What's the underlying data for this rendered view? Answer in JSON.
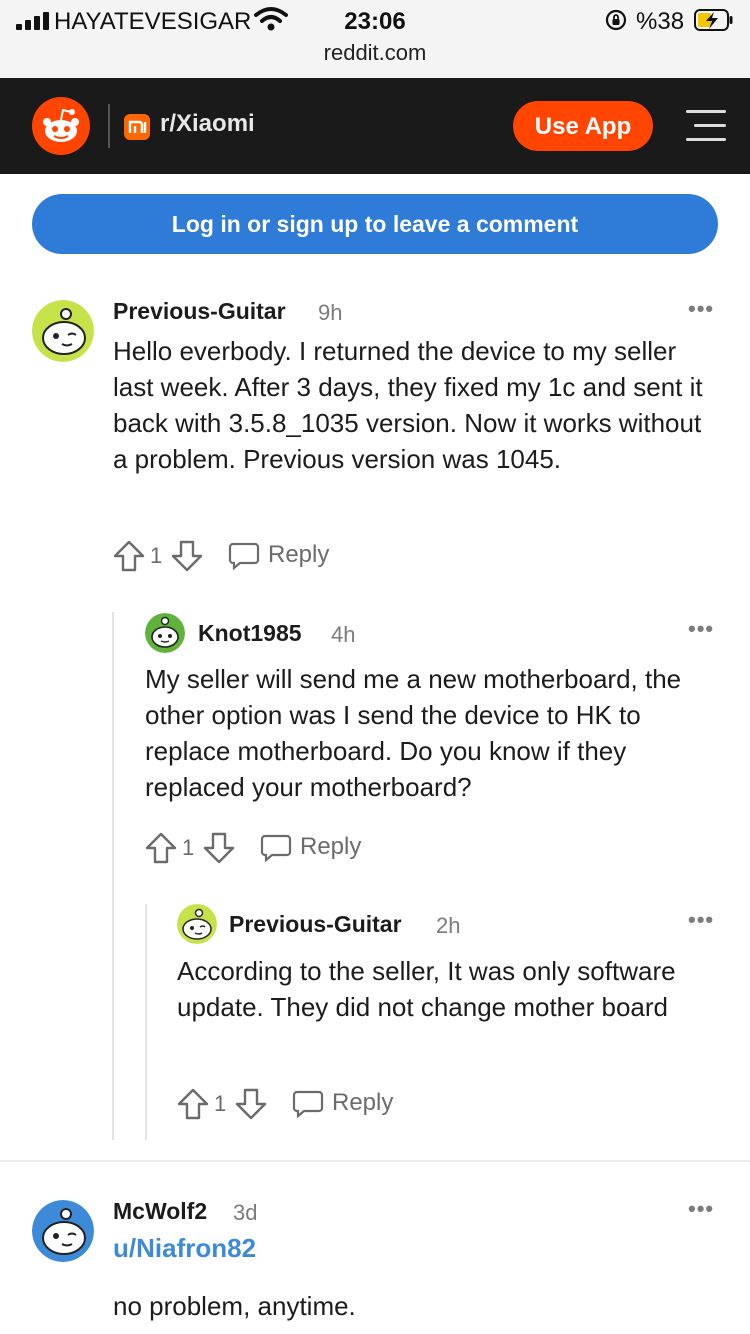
{
  "status_bar": {
    "carrier": "HAYATEVESIGAR",
    "time": "23:06",
    "url": "reddit.com",
    "battery": "%38"
  },
  "header": {
    "subreddit": "r/Xiaomi",
    "use_app_label": "Use App"
  },
  "login_prompt": "Log in or sign up to leave a comment",
  "comments": [
    {
      "author": "Previous-Guitar",
      "age": "9h",
      "body": "Hello everbody. I returned the device to my seller last week. After 3 days, they fixed my 1c and sent it back with 3.5.8_1035 version. Now it works without a problem. Previous version was 1045.",
      "votes": "1",
      "reply_label": "Reply"
    },
    {
      "author": "Knot1985",
      "age": "4h",
      "body": "My seller will send me a new motherboard, the other option was I send the device to HK to replace motherboard. Do you know if they replaced your motherboard?",
      "votes": "1",
      "reply_label": "Reply"
    },
    {
      "author": "Previous-Guitar",
      "age": "2h",
      "body": "According to the seller, It was only software update. They did not change mother board",
      "votes": "1",
      "reply_label": "Reply"
    },
    {
      "author": "McWolf2",
      "age": "3d",
      "flair": "u/Niafron82",
      "body": "no problem, anytime."
    }
  ],
  "more_label": "•••",
  "colors": {
    "header_bg": "#1a1a1b",
    "reddit_orange": "#ff4500",
    "login_blue": "#2f7bd8",
    "flair_blue": "#3d8bd8"
  }
}
